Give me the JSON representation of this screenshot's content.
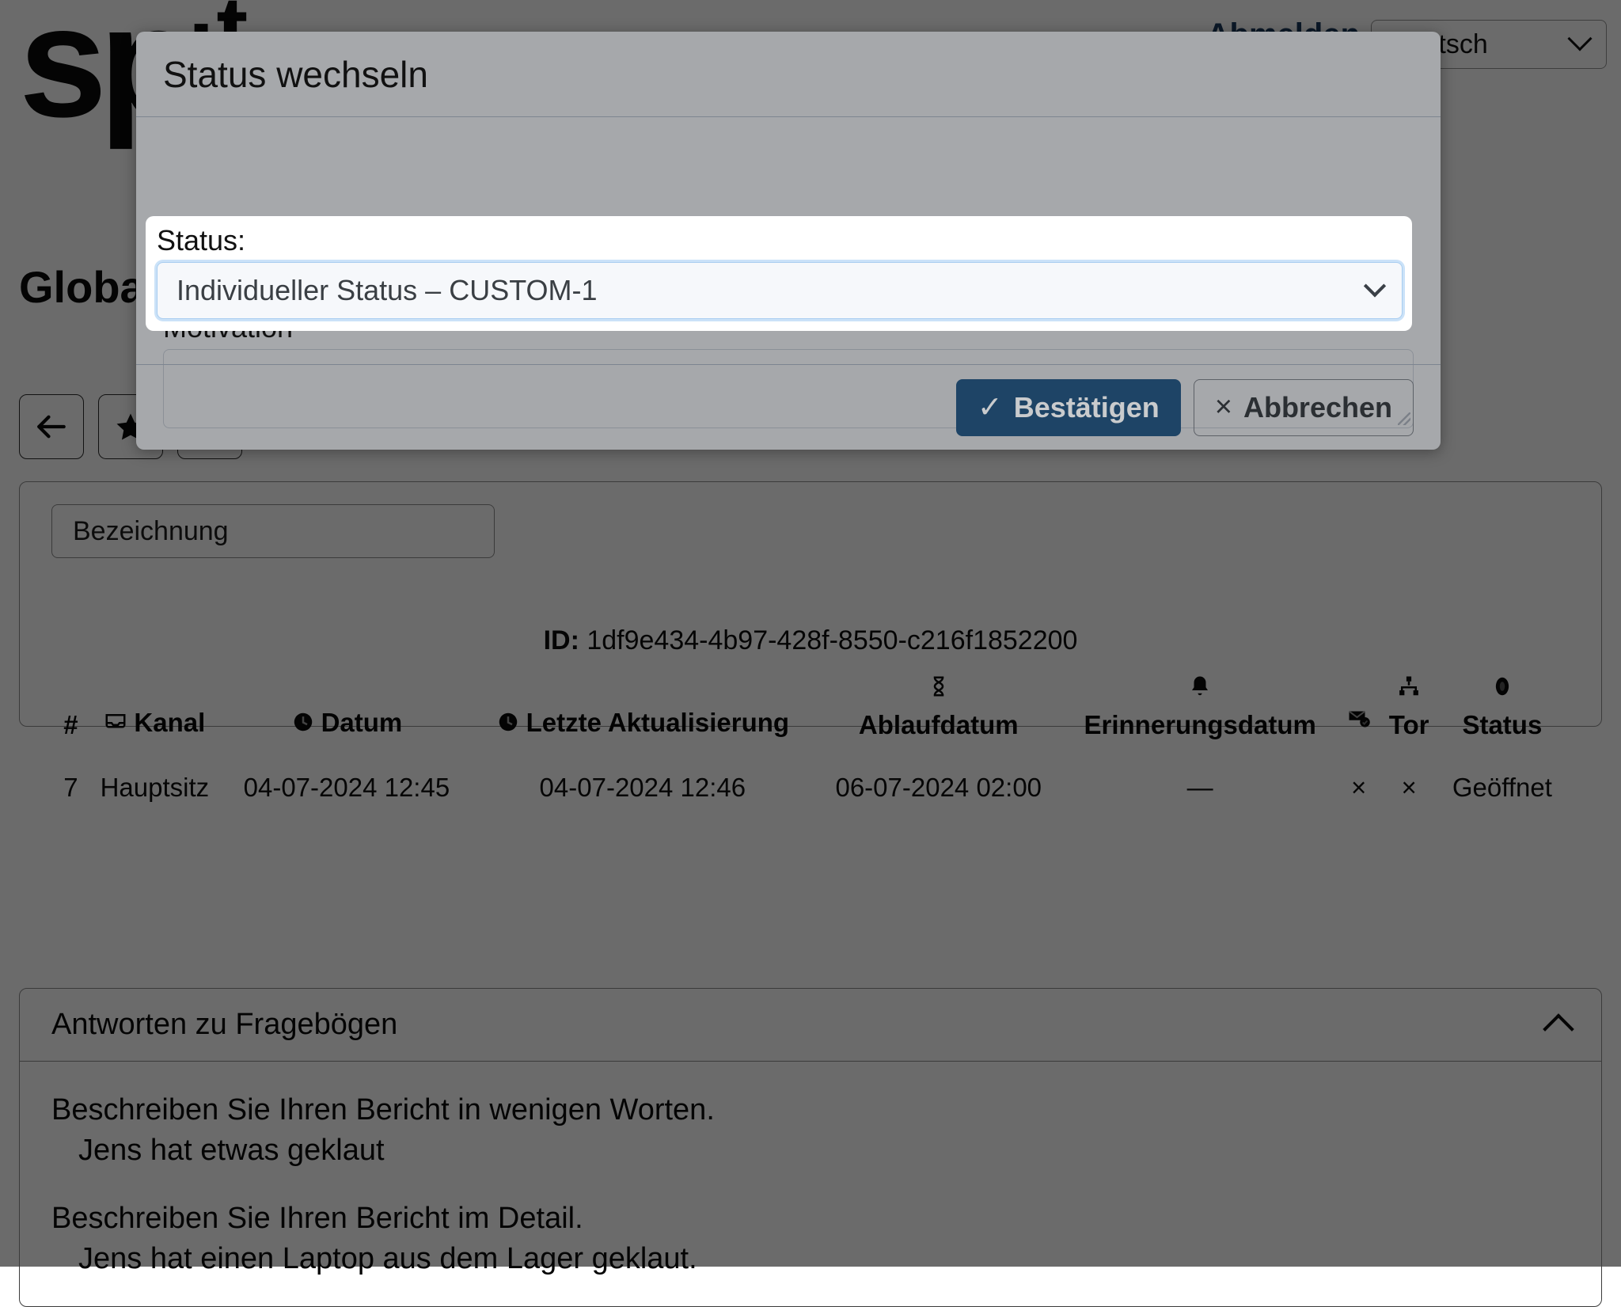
{
  "app": {
    "logo_text": "sp",
    "logo_mark": "·t",
    "top_right_link": "Abmelden",
    "language_value": "Deutsch",
    "language_icon": "chevron-down-icon"
  },
  "page": {
    "title": "Globale Berichte",
    "toolbar": [
      {
        "name": "back-button",
        "icon": "arrow-left-icon"
      },
      {
        "name": "favorite-button",
        "icon": "star-icon"
      },
      {
        "name": "third-button",
        "icon": "generic-icon"
      }
    ],
    "search_placeholder": "Bezeichnung"
  },
  "record": {
    "id_label": "ID:",
    "id_value": "1df9e434-4b97-428f-8550-c216f1852200",
    "table": {
      "columns": [
        {
          "label": "#",
          "icon": null
        },
        {
          "label": "Kanal",
          "icon": "inbox-icon"
        },
        {
          "label": "Datum",
          "icon": "clock-icon"
        },
        {
          "label": "Letzte Aktualisierung",
          "icon": "clock-icon"
        },
        {
          "label": "Ablaufdatum",
          "icon": "hourglass-icon"
        },
        {
          "label": "Erinnerungsdatum",
          "icon": "bell-icon"
        },
        {
          "label": "",
          "icon": "envelope-check-icon"
        },
        {
          "label": "Tor",
          "icon": "sitemap-icon"
        },
        {
          "label": "Status",
          "icon": "circle-icon"
        }
      ],
      "rows": [
        {
          "number": "7",
          "channel": "Hauptsitz",
          "date": "04-07-2024 12:45",
          "last_update": "04-07-2024 12:46",
          "expiry": "06-07-2024 02:00",
          "reminder": "—",
          "mail": "×",
          "gate": "×",
          "status": "Geöffnet"
        }
      ]
    }
  },
  "questionnaire": {
    "panel_title": "Antworten zu Fragebögen",
    "collapse_icon": "chevron-up-icon",
    "items": [
      {
        "question": "Beschreiben Sie Ihren Bericht in wenigen Worten.",
        "answer": "Jens hat etwas geklaut"
      },
      {
        "question": "Beschreiben Sie Ihren Bericht im Detail.",
        "answer": "Jens hat einen Laptop aus dem Lager geklaut."
      }
    ]
  },
  "modal": {
    "title": "Status wechseln",
    "status_label": "Status:",
    "status_value": "Individueller Status – CUSTOM-1",
    "status_dropdown_icon": "chevron-down-icon",
    "motivation_label": "Motivation",
    "motivation_value": "",
    "confirm_label": "Bestätigen",
    "confirm_icon": "check-icon",
    "confirm_glyph": "✓",
    "cancel_label": "Abbrechen",
    "cancel_icon": "close-icon",
    "cancel_glyph": "×",
    "accent_color": "#1e4466"
  }
}
